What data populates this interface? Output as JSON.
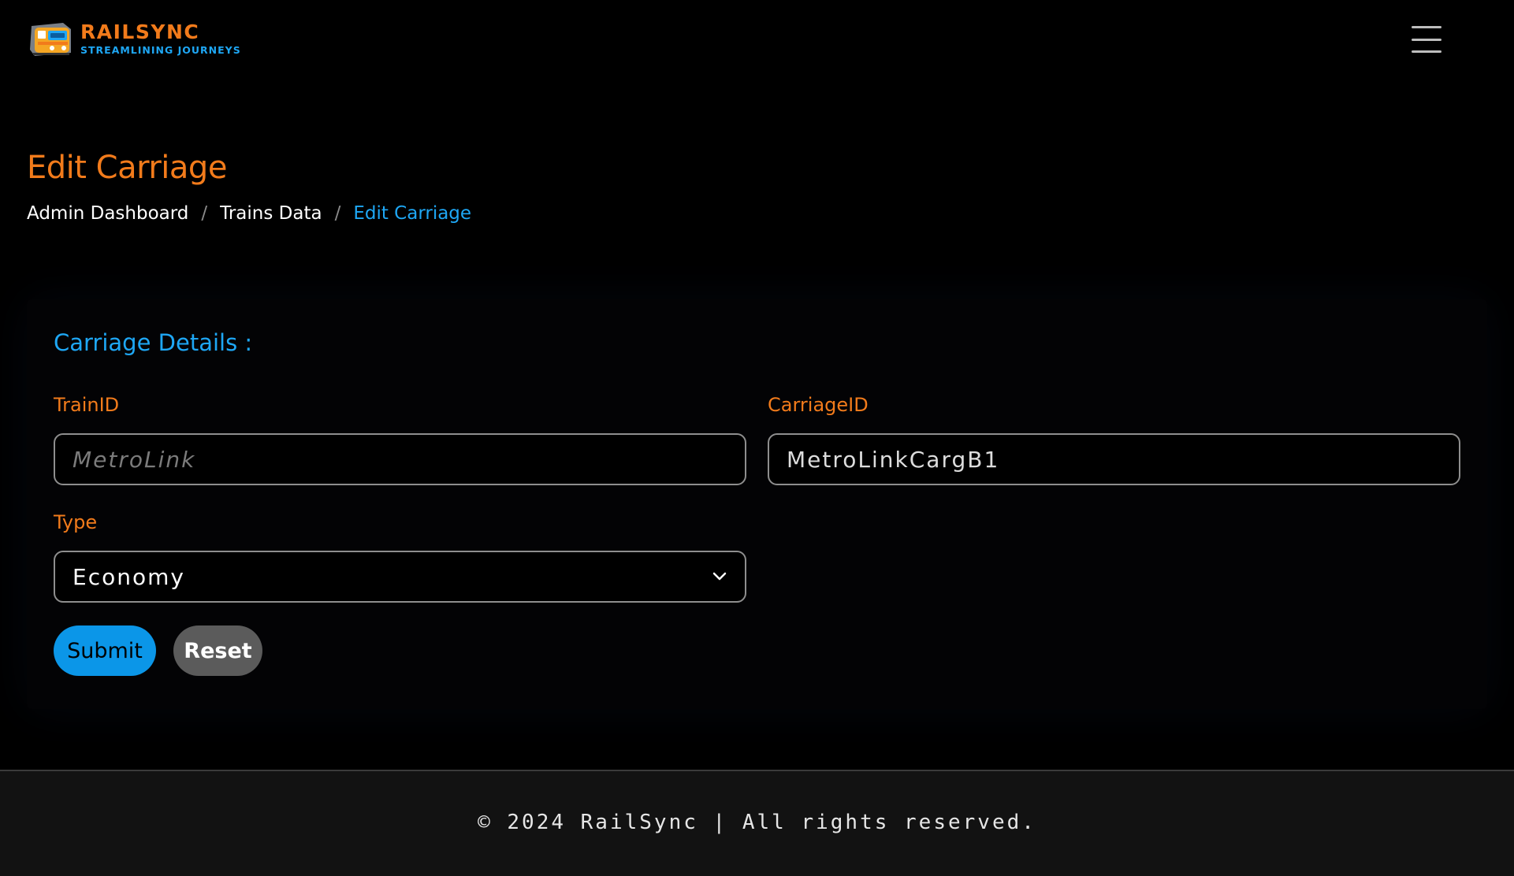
{
  "navbar": {
    "brand_name": "RAILSYNC",
    "brand_tagline": "STREAMLINING JOURNEYS",
    "logo_icon": "train-icon",
    "menu_icon": "hamburger-menu-icon"
  },
  "header": {
    "title": "Edit Carriage",
    "breadcrumb": [
      {
        "label": "Admin Dashboard"
      },
      {
        "label": "Trains Data"
      },
      {
        "label": "Edit Carriage"
      }
    ],
    "separator": "/"
  },
  "form": {
    "section_title": "Carriage Details :",
    "train_id": {
      "label": "TrainID",
      "placeholder": "MetroLink",
      "value": ""
    },
    "carriage_id": {
      "label": "CarriageID",
      "value": "MetroLinkCargB1"
    },
    "type": {
      "label": "Type",
      "selected": "Economy"
    },
    "submit_label": "Submit",
    "reset_label": "Reset"
  },
  "footer": {
    "text": "© 2024 RailSync | All rights reserved."
  },
  "colors": {
    "accent_orange": "#f27b1b",
    "accent_blue": "#1ea7f5",
    "submit_bg": "#0b96e8",
    "reset_bg": "#5b5b5b",
    "background": "#000000"
  }
}
